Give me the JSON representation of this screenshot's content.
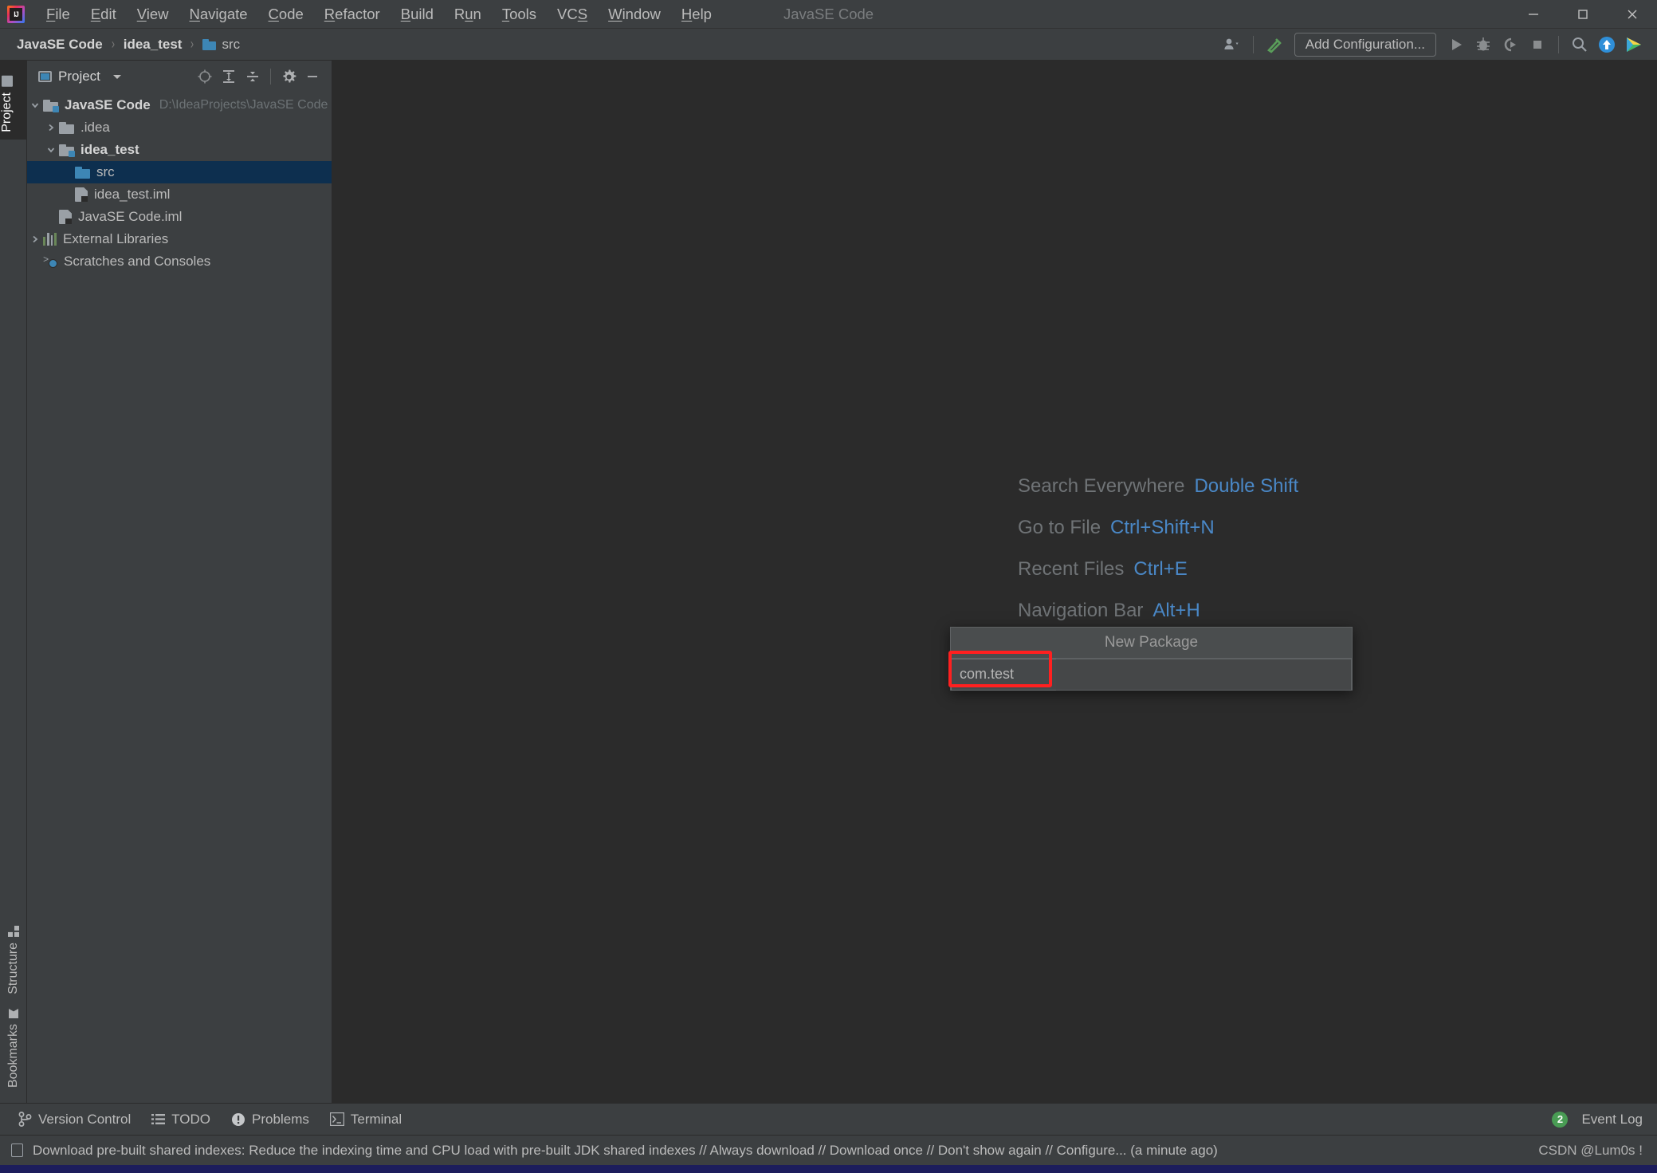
{
  "window": {
    "title": "JavaSE Code",
    "logo_icon": "intellij-idea-logo",
    "minimize_icon": "minimize-icon",
    "maximize_icon": "maximize-icon",
    "close_icon": "close-icon"
  },
  "menubar": {
    "items": [
      {
        "label": "File",
        "mnemonic": "F"
      },
      {
        "label": "Edit",
        "mnemonic": "E"
      },
      {
        "label": "View",
        "mnemonic": "V"
      },
      {
        "label": "Navigate",
        "mnemonic": "N"
      },
      {
        "label": "Code",
        "mnemonic": "C"
      },
      {
        "label": "Refactor",
        "mnemonic": "R"
      },
      {
        "label": "Build",
        "mnemonic": "B"
      },
      {
        "label": "Run",
        "mnemonic": "u"
      },
      {
        "label": "Tools",
        "mnemonic": "T"
      },
      {
        "label": "VCS",
        "mnemonic": "S"
      },
      {
        "label": "Window",
        "mnemonic": "W"
      },
      {
        "label": "Help",
        "mnemonic": "H"
      }
    ]
  },
  "navbar": {
    "breadcrumbs": [
      {
        "label": "JavaSE Code",
        "icon": null,
        "bold": true
      },
      {
        "label": "idea_test",
        "icon": null,
        "bold": true
      },
      {
        "label": "src",
        "icon": "source-folder-icon",
        "bold": false
      }
    ],
    "separator": "›",
    "add_configuration_label": "Add Configuration...",
    "icons": [
      "user-dropdown-icon",
      "hammer-build-icon",
      "run-icon",
      "debug-icon",
      "run-with-coverage-icon",
      "stop-icon",
      "search-icon",
      "update-project-icon",
      "ide-services-icon"
    ]
  },
  "left_strip": {
    "top_tabs": [
      {
        "label": "Project",
        "icon": "folder-icon",
        "active": true
      }
    ],
    "bottom_tabs": [
      {
        "label": "Structure",
        "icon": "structure-icon",
        "active": false
      },
      {
        "label": "Bookmarks",
        "icon": "bookmark-icon",
        "active": false
      }
    ]
  },
  "project_panel": {
    "title": "Project",
    "title_icon": "project-view-icon",
    "dropdown_icon": "chevron-down-icon",
    "tools": [
      "select-opened-file-icon",
      "expand-all-icon",
      "collapse-all-icon",
      "gear-icon",
      "hide-icon"
    ],
    "tree": [
      {
        "label": "JavaSE Code",
        "path": "D:\\IdeaProjects\\JavaSE Code",
        "icon": "module-folder-icon",
        "arrow": "expanded",
        "indent": 0,
        "bold": true,
        "selected": false
      },
      {
        "label": ".idea",
        "path": "",
        "icon": "plain-folder-icon",
        "arrow": "collapsed",
        "indent": 1,
        "bold": false,
        "selected": false
      },
      {
        "label": "idea_test",
        "path": "",
        "icon": "module-folder-icon",
        "arrow": "expanded",
        "indent": 1,
        "bold": true,
        "selected": false
      },
      {
        "label": "src",
        "path": "",
        "icon": "source-folder-icon",
        "arrow": "none",
        "indent": 2,
        "bold": false,
        "selected": true
      },
      {
        "label": "idea_test.iml",
        "path": "",
        "icon": "iml-file-icon",
        "arrow": "none",
        "indent": 2,
        "bold": false,
        "selected": false
      },
      {
        "label": "JavaSE Code.iml",
        "path": "",
        "icon": "iml-file-icon",
        "arrow": "none",
        "indent": 1,
        "bold": false,
        "selected": false
      },
      {
        "label": "External Libraries",
        "path": "",
        "icon": "libraries-icon",
        "arrow": "collapsed",
        "indent": 0,
        "bold": false,
        "selected": false
      },
      {
        "label": "Scratches and Consoles",
        "path": "",
        "icon": "scratches-icon",
        "arrow": "none",
        "indent": 0,
        "bold": false,
        "selected": false
      }
    ]
  },
  "editor": {
    "tips": [
      {
        "action": "Search Everywhere",
        "shortcut": "Double Shift"
      },
      {
        "action": "Go to File",
        "shortcut": "Ctrl+Shift+N"
      },
      {
        "action": "Recent Files",
        "shortcut": "Ctrl+E"
      },
      {
        "action": "Navigation Bar",
        "shortcut": "Alt+H"
      }
    ]
  },
  "new_package_popup": {
    "title": "New Package",
    "input_value": "com.test",
    "input_placeholder": ""
  },
  "annotation": {
    "highlight_color": "#ff2020"
  },
  "tool_windows": {
    "items": [
      {
        "label": "Version Control",
        "icon": "branch-icon"
      },
      {
        "label": "TODO",
        "icon": "list-icon"
      },
      {
        "label": "Problems",
        "icon": "problems-icon"
      },
      {
        "label": "Terminal",
        "icon": "terminal-icon"
      }
    ],
    "event_log": {
      "label": "Event Log",
      "count": "2",
      "badge_color": "#499c54"
    }
  },
  "statusbar": {
    "icon": "notification-icon",
    "message": "Download pre-built shared indexes: Reduce the indexing time and CPU load with pre-built JDK shared indexes // Always download // Download once // Don't show again // Configure... (a minute ago)",
    "watermark": "CSDN @Lum0s !"
  }
}
